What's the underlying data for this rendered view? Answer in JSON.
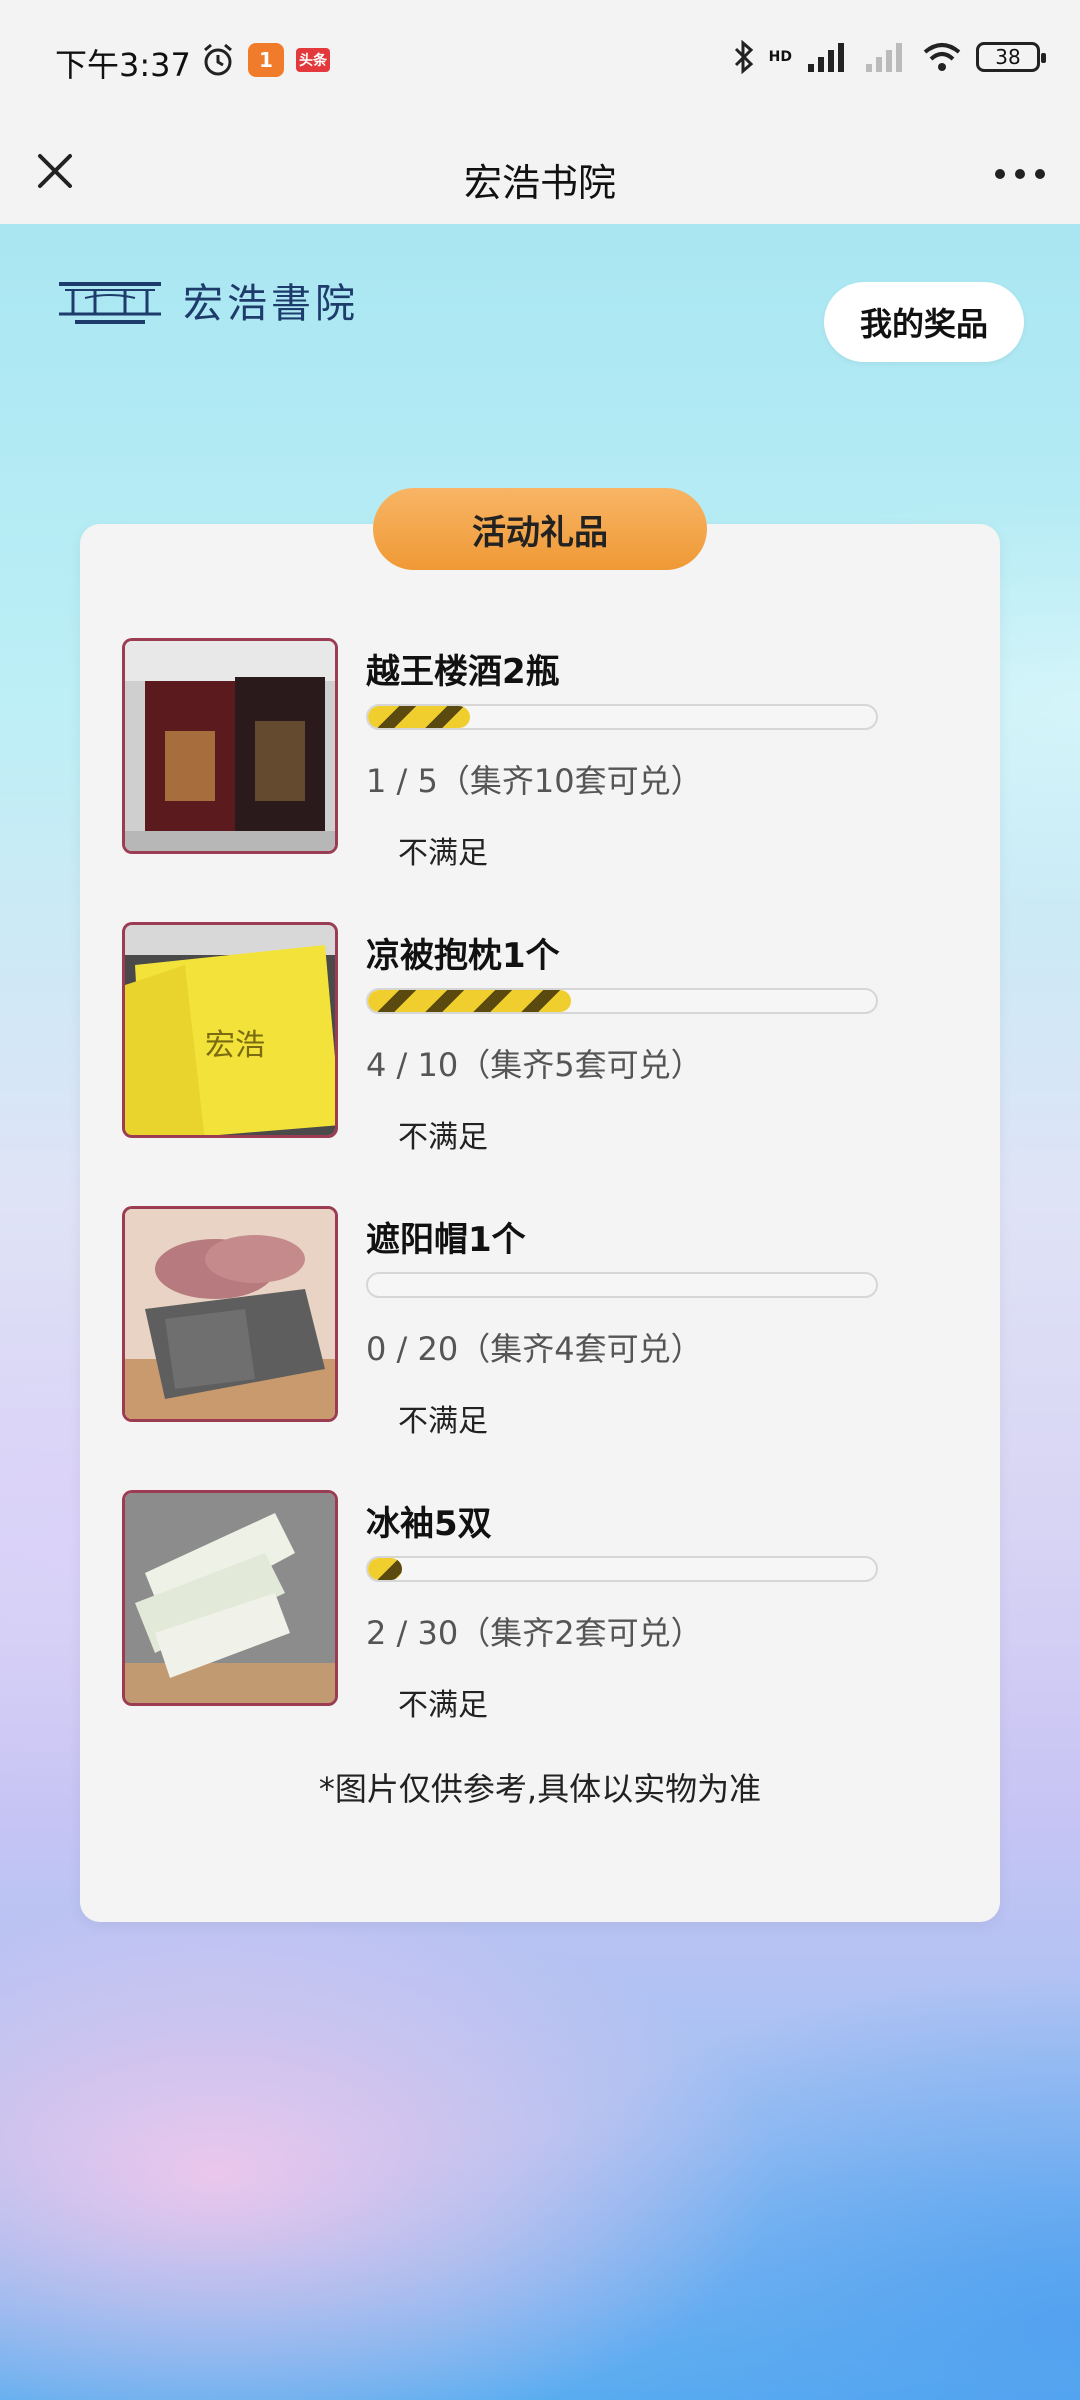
{
  "status_bar": {
    "time": "下午3:37",
    "app_badge": "1",
    "app_badge2": "头条",
    "network_label": "HD",
    "battery": "38"
  },
  "nav": {
    "title": "宏浩书院"
  },
  "brand": {
    "logo_text": "宏浩書院"
  },
  "my_prizes_label": "我的奖品",
  "section_title": "活动礼品",
  "prizes": [
    {
      "name": "越王楼酒2瓶",
      "progress_text": "1 / 5（集齐10套可兑）",
      "progress_fraction": 0.2,
      "status": "不满足"
    },
    {
      "name": "凉被抱枕1个",
      "progress_text": "4 / 10（集齐5套可兑）",
      "progress_fraction": 0.4,
      "status": "不满足"
    },
    {
      "name": "遮阳帽1个",
      "progress_text": "0 / 20（集齐4套可兑）",
      "progress_fraction": 0.0,
      "status": "不满足"
    },
    {
      "name": "冰袖5双",
      "progress_text": "2 / 30（集齐2套可兑）",
      "progress_fraction": 0.0667,
      "status": "不满足"
    }
  ],
  "disclaimer": "*图片仅供参考,具体以实物为准",
  "colors": {
    "accent_orange": "#ef9935",
    "progress_yellow": "#f0ce2d",
    "thumb_border": "#9b3c52"
  }
}
